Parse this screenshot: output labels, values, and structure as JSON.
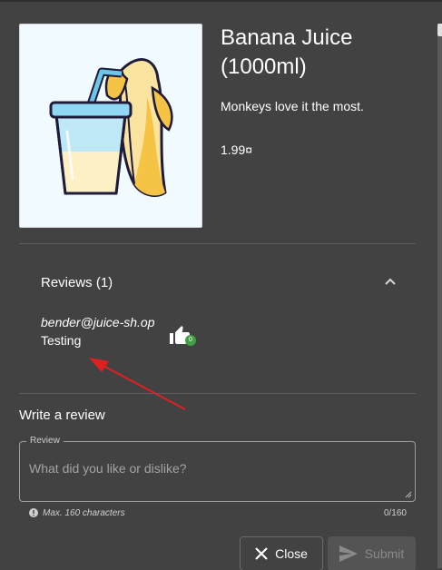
{
  "product": {
    "title": "Banana Juice (1000ml)",
    "description": "Monkeys love it the most.",
    "price": "1.99¤",
    "image_icon": "banana-juice-image"
  },
  "reviews": {
    "header": "Reviews (1)",
    "expanded": true,
    "items": [
      {
        "author": "bender@juice-sh.op",
        "text": "Testing",
        "likes": "0"
      }
    ]
  },
  "write_review": {
    "title": "Write a review",
    "field_label": "Review",
    "placeholder": "What did you like or dislike?",
    "value": "",
    "hint": "Max. 160 characters",
    "counter": "0/160"
  },
  "actions": {
    "close_label": "Close",
    "submit_label": "Submit",
    "submit_enabled": false
  },
  "colors": {
    "background": "#424242",
    "like_badge": "#43a047",
    "annotation_arrow": "#e02020"
  }
}
